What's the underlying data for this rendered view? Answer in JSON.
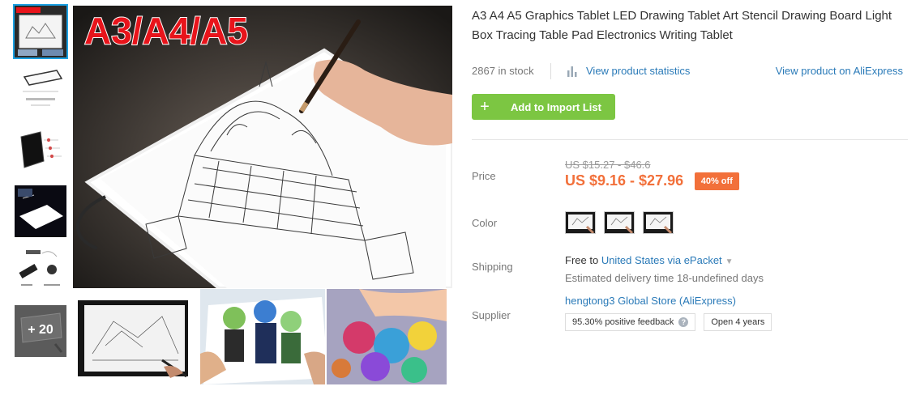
{
  "gallery": {
    "banner_text": "A3/A4/A5",
    "more_count": "+ 20"
  },
  "product": {
    "title": "A3 A4 A5 Graphics Tablet LED Drawing Tablet Art Stencil Drawing Board Light Box Tracing Table Pad Electronics Writing Tablet",
    "stock": "2867 in stock",
    "stats_link": "View product statistics",
    "aliexpress_link": "View product on AliExpress",
    "add_button": "Add to Import List"
  },
  "price": {
    "label": "Price",
    "original": "US $15.27 - $46.6",
    "current": "US $9.16 - $27.96",
    "discount": "40% off"
  },
  "color": {
    "label": "Color",
    "swatch_count": 3
  },
  "shipping": {
    "label": "Shipping",
    "free_prefix": "Free to",
    "destination": "United States via ePacket",
    "estimate": "Estimated delivery time 18-undefined days"
  },
  "supplier": {
    "label": "Supplier",
    "store_name": "hengtong3 Global Store (AliExpress)",
    "feedback": "95.30% positive feedback",
    "open_years": "Open 4 years"
  },
  "colors": {
    "accent_blue": "#2a7ab8",
    "price_orange": "#f2703a",
    "add_green": "#7cc642",
    "active_outline": "#1ba0e2"
  },
  "icons": [
    "plus-icon",
    "bar-chart-icon",
    "chevron-down-icon",
    "question-icon"
  ]
}
